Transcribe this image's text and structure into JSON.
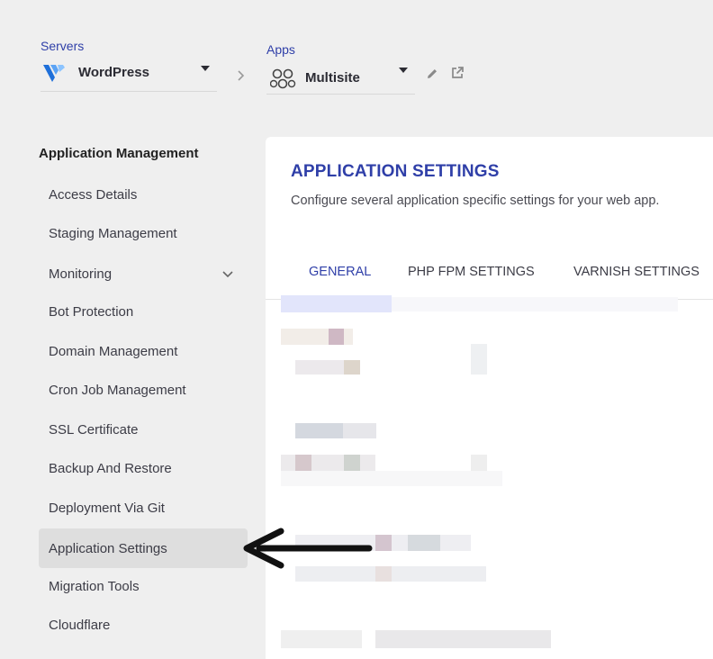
{
  "header": {
    "servers_label": "Servers",
    "server_name": "WordPress",
    "apps_label": "Apps",
    "app_name": "Multisite"
  },
  "sidebar": {
    "title": "Application Management",
    "items": [
      {
        "label": "Access Details"
      },
      {
        "label": "Staging Management"
      },
      {
        "label": "Monitoring"
      },
      {
        "label": "Bot Protection"
      },
      {
        "label": "Domain Management"
      },
      {
        "label": "Cron Job Management"
      },
      {
        "label": "SSL Certificate"
      },
      {
        "label": "Backup And Restore"
      },
      {
        "label": "Deployment Via Git"
      },
      {
        "label": "Application Settings"
      },
      {
        "label": "Migration Tools"
      },
      {
        "label": "Cloudflare"
      }
    ],
    "active_item": "Application Settings"
  },
  "main": {
    "title": "APPLICATION SETTINGS",
    "description": "Configure several application specific settings for your web app.",
    "tabs": [
      {
        "label": "GENERAL"
      },
      {
        "label": "PHP FPM SETTINGS"
      },
      {
        "label": "VARNISH SETTINGS"
      }
    ],
    "active_tab": "GENERAL"
  },
  "colors": {
    "accent": "#2f3fa8",
    "background": "#efefef",
    "active_item_bg": "#dedede",
    "vultr_blue": "#1e6fd9"
  },
  "icons": [
    "vultr-logo-icon",
    "wordpress-multisite-icon",
    "chevron-right-icon",
    "chevron-down-icon",
    "edit-pencil-icon",
    "external-link-icon",
    "pointer-arrow"
  ]
}
